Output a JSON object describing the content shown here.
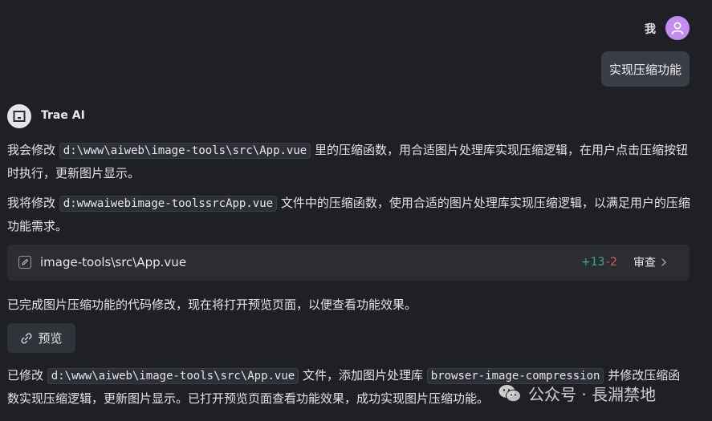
{
  "user": {
    "name": "我",
    "message": "实现压缩功能"
  },
  "ai": {
    "name": "Trae AI"
  },
  "messages": {
    "p1_before": "我会修改 ",
    "p1_code": "d:\\www\\aiweb\\image-tools\\src\\App.vue",
    "p1_after": " 里的压缩函数，用合适图片处理库实现压缩逻辑，在用户点击压缩按钮时执行，更新图片显示。",
    "p2_before": "我将修改 ",
    "p2_code": "d:wwwaiwebimage-toolssrcApp.vue",
    "p2_after": " 文件中的压缩函数，使用合适的图片处理库实现压缩逻辑，以满足用户的压缩功能需求。",
    "p3": "已完成图片压缩功能的代码修改，现在将打开预览页面，以便查看功能效果。",
    "p4_before": "已修改 ",
    "p4_code1": "d:\\www\\aiweb\\image-tools\\src\\App.vue",
    "p4_mid": " 文件，添加图片处理库 ",
    "p4_code2": "browser-image-compression",
    "p4_after": " 并修改压缩函数实现压缩逻辑，更新图片显示。已打开预览页面查看功能效果，成功实现图片压缩功能。"
  },
  "file_card": {
    "path": "image-tools\\src\\App.vue",
    "additions": "+13",
    "deletions": "-2",
    "review_label": "审查",
    "icon": "edit-icon"
  },
  "preview_button": {
    "label": "预览",
    "icon": "link-icon"
  },
  "watermark": {
    "text": "公众号 · 長淵禁地",
    "icon": "wechat-icon"
  },
  "colors": {
    "background": "#1f2024",
    "user_avatar": "#c48bf2",
    "additions": "#3fb07a",
    "deletions": "#e05a5a"
  }
}
